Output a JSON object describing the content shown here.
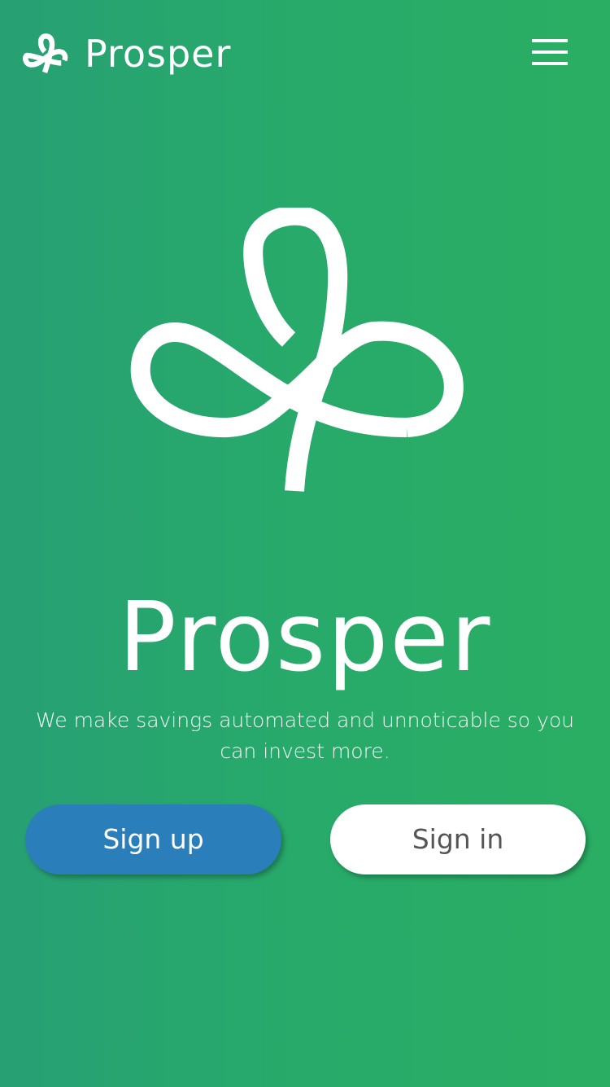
{
  "header": {
    "brand_name": "Prosper",
    "logo_icon": "prosper-leaf-icon",
    "menu_icon": "hamburger-menu-icon"
  },
  "hero": {
    "logo_icon": "prosper-leaf-icon",
    "title": "Prosper",
    "tagline": "We make savings automated and unnoticable so you can invest more."
  },
  "actions": {
    "signup_label": "Sign up",
    "signin_label": "Sign in"
  },
  "colors": {
    "background_start": "#27a074",
    "background_end": "#2aae63",
    "signup_button": "#2a7eba",
    "signin_button": "#ffffff",
    "signin_text": "#555555"
  }
}
